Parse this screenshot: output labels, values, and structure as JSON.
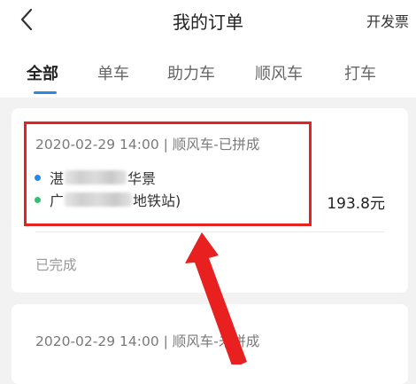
{
  "header": {
    "title": "我的订单",
    "invoice_label": "开发票",
    "back_icon": "chevron-left-icon"
  },
  "tabs": [
    {
      "label": "全部",
      "active": true
    },
    {
      "label": "单车",
      "active": false
    },
    {
      "label": "助力车",
      "active": false
    },
    {
      "label": "顺风车",
      "active": false
    },
    {
      "label": "打车",
      "active": false
    }
  ],
  "orders": [
    {
      "meta": "2020-02-29 14:00 | 顺风车-已拼成",
      "origin_start": "湛",
      "origin_end": "华景",
      "destination_start": "广",
      "destination_end": "地铁站)",
      "price": "193.8元",
      "status": "已完成"
    },
    {
      "meta": "2020-02-29 14:00 | 顺风车-未拼成"
    }
  ],
  "colors": {
    "accent": "#2a87e8",
    "origin_dot": "#2a87e8",
    "destination_dot": "#27c46b",
    "annotation": "#e82020"
  }
}
